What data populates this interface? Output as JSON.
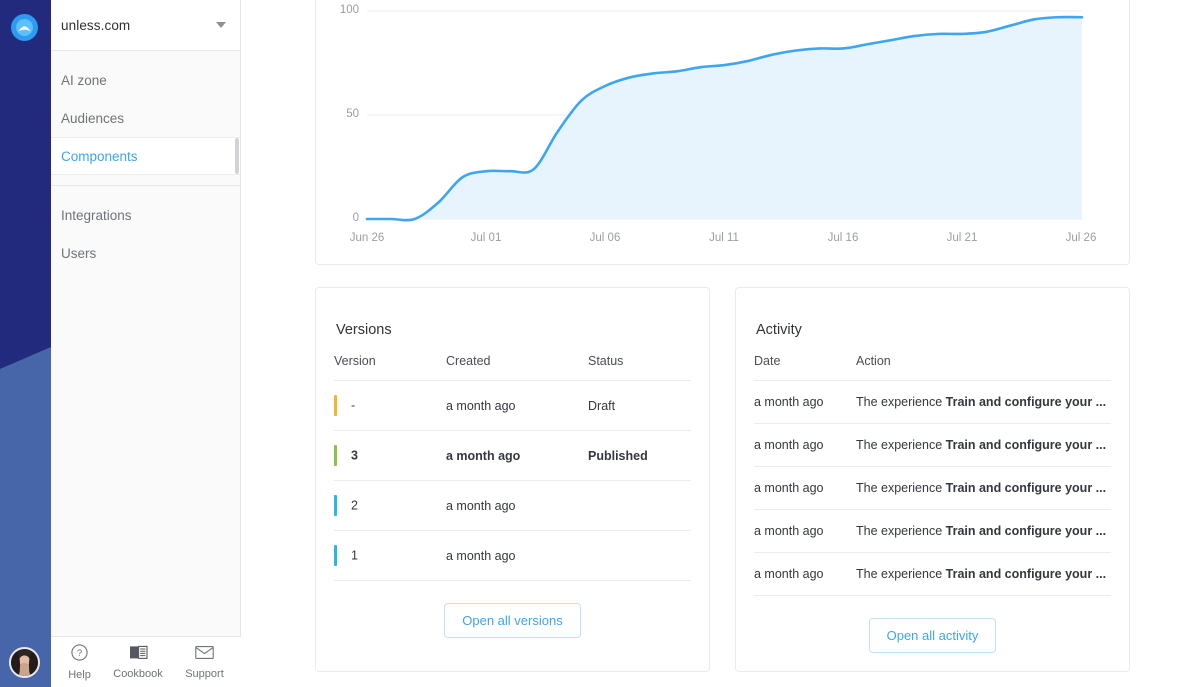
{
  "brand": {
    "logo_icon": "unless-arch-logo",
    "navy": "#222A7E",
    "rail_blue": "#4766AA",
    "accent": "#3EA5F0"
  },
  "sidebar": {
    "org": {
      "name": "unless.com",
      "caret_icon": "chevron-down-icon"
    },
    "groups": [
      {
        "items": [
          {
            "label": "AI zone",
            "active": false
          },
          {
            "label": "Audiences",
            "active": false
          },
          {
            "label": "Components",
            "active": true
          }
        ]
      },
      {
        "items": [
          {
            "label": "Integrations",
            "active": false
          },
          {
            "label": "Users",
            "active": false
          }
        ]
      }
    ],
    "footer": [
      {
        "label": "Help",
        "icon": "question-circle-icon"
      },
      {
        "label": "Cookbook",
        "icon": "open-book-icon"
      },
      {
        "label": "Support",
        "icon": "envelope-icon"
      }
    ]
  },
  "chart_data": {
    "type": "area",
    "title": "",
    "xlabel": "",
    "ylabel": "",
    "ylim": [
      0,
      100
    ],
    "yticks": [
      0,
      50,
      100
    ],
    "ytick_labels": [
      "0",
      "50",
      "100"
    ],
    "xtick_labels": [
      "Jun 26",
      "Jul 01",
      "Jul 06",
      "Jul 11",
      "Jul 16",
      "Jul 21",
      "Jul 26"
    ],
    "grid": true,
    "legend": "none",
    "line_color": "#3EA5F0",
    "fill_color": "#E8F4FD",
    "x": [
      "Jun 26",
      "Jun 27",
      "Jun 28",
      "Jun 29",
      "Jun 30",
      "Jul 01",
      "Jul 02",
      "Jul 03",
      "Jul 04",
      "Jul 05",
      "Jul 06",
      "Jul 07",
      "Jul 08",
      "Jul 09",
      "Jul 10",
      "Jul 11",
      "Jul 12",
      "Jul 13",
      "Jul 14",
      "Jul 15",
      "Jul 16",
      "Jul 17",
      "Jul 18",
      "Jul 19",
      "Jul 20",
      "Jul 21",
      "Jul 22",
      "Jul 23",
      "Jul 24",
      "Jul 25",
      "Jul 26"
    ],
    "values": [
      0,
      0,
      0,
      8,
      20,
      23,
      23,
      24,
      42,
      57,
      64,
      68,
      70,
      71,
      73,
      74,
      76,
      79,
      81,
      82,
      82,
      84,
      86,
      88,
      89,
      89,
      90,
      93,
      96,
      97,
      97
    ]
  },
  "versions_panel": {
    "title": "Versions",
    "columns": [
      "Version",
      "Created",
      "Status"
    ],
    "rows": [
      {
        "marker_color": "#F5B32E",
        "version": "-",
        "created": "a month ago",
        "status": "Draft",
        "bold": false
      },
      {
        "marker_color": "#8BC34A",
        "version": "3",
        "created": "a month ago",
        "status": "Published",
        "bold": true
      },
      {
        "marker_color": "#29B6E8",
        "version": "2",
        "created": "a month ago",
        "status": "",
        "bold": false
      },
      {
        "marker_color": "#29B6E8",
        "version": "1",
        "created": "a month ago",
        "status": "",
        "bold": false
      }
    ],
    "button_label": "Open all versions"
  },
  "activity_panel": {
    "title": "Activity",
    "columns": [
      "Date",
      "Action"
    ],
    "rows": [
      {
        "date": "a month ago",
        "action_prefix": "The experience ",
        "action_bold": "Train and configure your ..."
      },
      {
        "date": "a month ago",
        "action_prefix": "The experience ",
        "action_bold": "Train and configure your ..."
      },
      {
        "date": "a month ago",
        "action_prefix": "The experience ",
        "action_bold": "Train and configure your ..."
      },
      {
        "date": "a month ago",
        "action_prefix": "The experience ",
        "action_bold": "Train and configure your ..."
      },
      {
        "date": "a month ago",
        "action_prefix": "The experience ",
        "action_bold": "Train and configure your ..."
      }
    ],
    "button_label": "Open all activity"
  }
}
